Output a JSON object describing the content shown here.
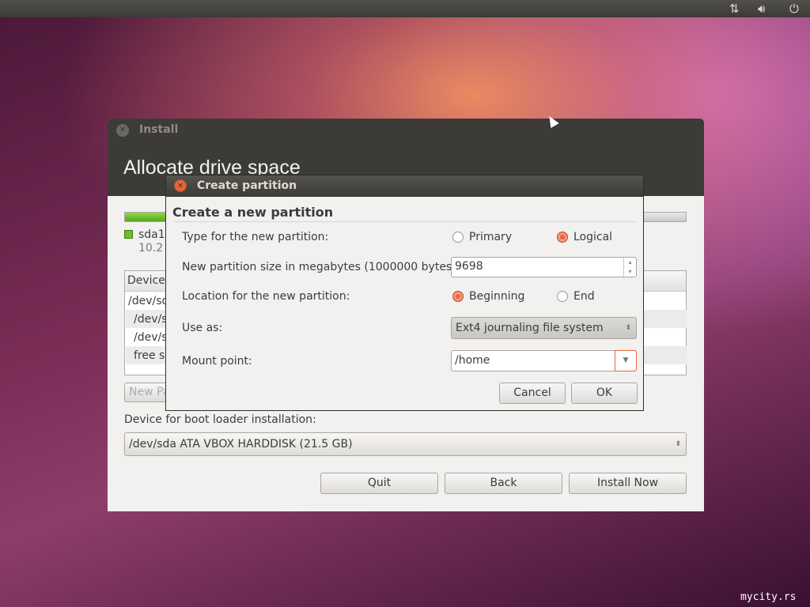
{
  "panel": {
    "icons": [
      "network-icon",
      "volume-icon",
      "power-icon"
    ]
  },
  "install": {
    "title": "Install",
    "heading": "Allocate drive space",
    "legend": {
      "name": "sda1",
      "size": "10.2 GB"
    },
    "table": {
      "header": "Device",
      "rows": [
        "/dev/sda",
        "/dev/sda1",
        "/dev/sda5",
        "free space"
      ]
    },
    "new_partition_label": "New Partition Table...",
    "boot_label": "Device for boot loader installation:",
    "boot_device": "/dev/sda ATA VBOX HARDDISK (21.5 GB)",
    "buttons": {
      "quit": "Quit",
      "back": "Back",
      "install": "Install Now"
    }
  },
  "dialog": {
    "title": "Create partition",
    "heading": "Create a new partition",
    "type_label": "Type for the new partition:",
    "type_primary": "Primary",
    "type_logical": "Logical",
    "type_selected": "Logical",
    "size_label": "New partition size in megabytes (1000000 bytes):",
    "size_value": "9698",
    "location_label": "Location for the new partition:",
    "loc_beginning": "Beginning",
    "loc_end": "End",
    "loc_selected": "Beginning",
    "use_as_label": "Use as:",
    "use_as_value": "Ext4 journaling file system",
    "mount_label": "Mount point:",
    "mount_value": "/home",
    "cancel": "Cancel",
    "ok": "OK"
  },
  "watermark": "mycity.rs",
  "colors": {
    "accent": "#e8663c",
    "partition_green": "#6fbf2a"
  }
}
